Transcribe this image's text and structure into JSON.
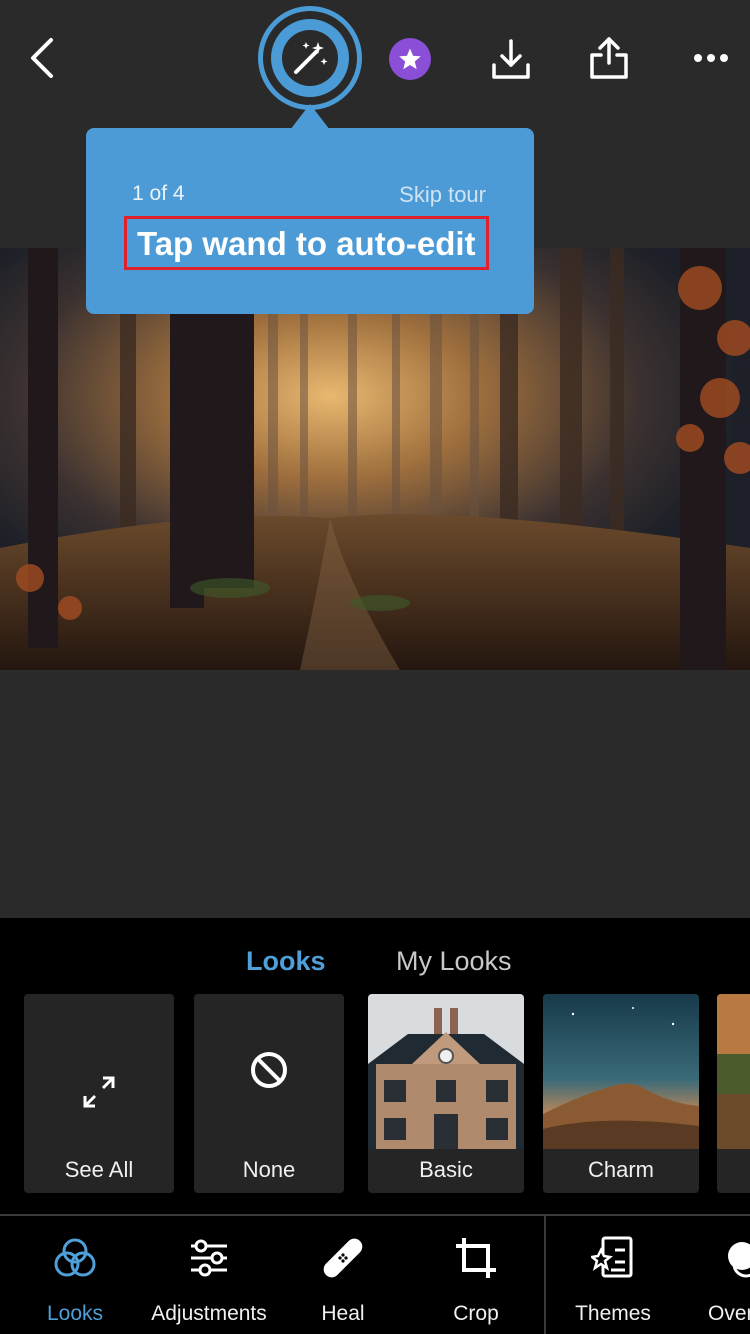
{
  "header": {
    "back_icon": "chevron-left-icon",
    "auto_icon": "magic-wand-icon",
    "premium_icon": "star-badge-icon",
    "download_icon": "download-icon",
    "share_icon": "share-icon",
    "more_icon": "more-dots-icon"
  },
  "tooltip": {
    "step": "1 of 4",
    "skip": "Skip tour",
    "title": "Tap wand to auto-edit"
  },
  "looks": {
    "tabs": [
      "Looks",
      "My Looks"
    ],
    "presets": [
      {
        "label": "See All",
        "icon": "expand-icon"
      },
      {
        "label": "None",
        "icon": "no-icon"
      },
      {
        "label": "Basic"
      },
      {
        "label": "Charm"
      }
    ]
  },
  "toolbar": {
    "tools": [
      {
        "label": "Looks",
        "icon": "looks-icon"
      },
      {
        "label": "Adjustments",
        "icon": "sliders-icon"
      },
      {
        "label": "Heal",
        "icon": "bandage-icon"
      },
      {
        "label": "Crop",
        "icon": "crop-icon"
      },
      {
        "label": "Themes",
        "icon": "themes-icon"
      },
      {
        "label": "Over",
        "icon": "overlay-icon"
      }
    ]
  },
  "colors": {
    "accent": "#4f9fd8",
    "tooltip": "#4d9bd6",
    "highlight": "#e0202a",
    "premium": "#8a4fd6"
  }
}
